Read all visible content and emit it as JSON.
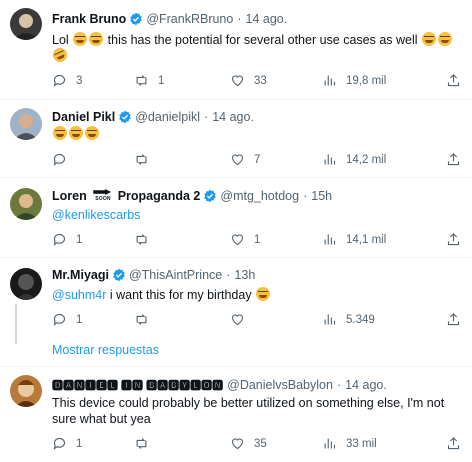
{
  "tweets": [
    {
      "name": "Frank Bruno",
      "handle": "@FrankRBruno",
      "time": "14 ago.",
      "text_pre": "Lol",
      "text_mid": "this has the potential for several other use cases as well",
      "replies": "3",
      "retweets": "1",
      "likes": "33",
      "views": "19,8 mil",
      "avatar_color": "#3a3a3a"
    },
    {
      "name": "Daniel Pikl",
      "handle": "@danielpikl",
      "time": "14 ago.",
      "replies": "",
      "retweets": "",
      "likes": "7",
      "views": "14,2 mil",
      "avatar_color": "#7f97b0"
    },
    {
      "name_pre": "Loren",
      "soon_label": "SOON",
      "name_post": "Propaganda 2",
      "handle": "@mtg_hotdog",
      "time": "15h",
      "mention": "@kenlikescarbs",
      "replies": "1",
      "retweets": "",
      "likes": "1",
      "views": "14,1 mil",
      "avatar_color": "#6b7a3c"
    },
    {
      "name": "Mr.Miyagi",
      "handle": "@ThisAintPrince",
      "time": "13h",
      "mention": "@suhm4r",
      "text": " i want this for my birthday",
      "replies": "1",
      "retweets": "",
      "likes": "",
      "views": "5.349",
      "avatar_color": "#1a1a1a"
    },
    {
      "name": "🅳🅰🅽🅸🅴🅻 🅸🅽 🅱🅰🅱🆈🅻🅾🅽",
      "handle": "@DanielvsBabylon",
      "time": "14 ago.",
      "text": "This device could probably be better utilized on something else, I'm not sure what but yea",
      "replies": "1",
      "retweets": "",
      "likes": "35",
      "views": "33 mil",
      "avatar_color": "#b87a3a"
    }
  ],
  "show_more_label": "Mostrar respuestas",
  "separator": "·",
  "accent": "#1d9bf0"
}
